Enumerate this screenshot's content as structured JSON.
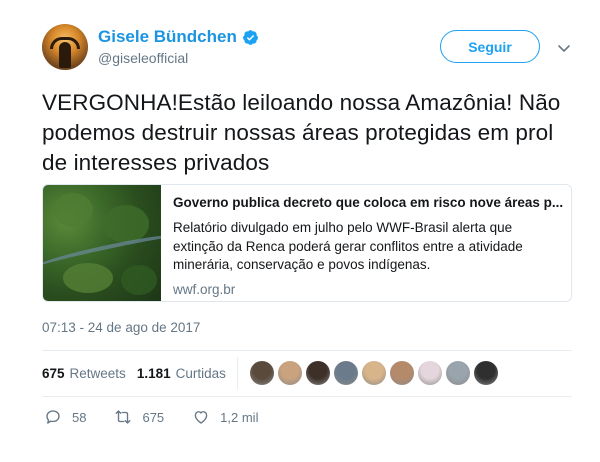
{
  "user": {
    "name": "Gisele Bündchen",
    "handle": "@giseleofficial",
    "follow_label": "Seguir"
  },
  "tweet": {
    "text": "VERGONHA!Estão leiloando nossa Amazônia! Não podemos destruir nossas áreas protegidas em prol de interesses privados",
    "timestamp": "07:13 - 24 de ago de 2017"
  },
  "card": {
    "title": "Governo publica decreto que coloca em risco nove áreas p...",
    "description": "Relatório divulgado em julho pelo WWF-Brasil alerta que extinção da Renca poderá gerar conflitos entre a atividade minerária, conservação e povos indígenas.",
    "domain": "wwf.org.br"
  },
  "stats": {
    "retweets_count": "675",
    "retweets_label": "Retweets",
    "likes_count": "1.181",
    "likes_label": "Curtidas"
  },
  "actions": {
    "reply_count": "58",
    "retweet_count": "675",
    "like_count": "1,2 mil"
  },
  "colors": {
    "accent": "#1da1f2",
    "name": "#1b95e0",
    "muted": "#657786",
    "text": "#14171a",
    "border": "#e1e8ed"
  },
  "liker_avatars": [
    "#5a4a3c",
    "#c9a27e",
    "#3d3028",
    "#6b7b8c",
    "#d8b48a",
    "#b58a6a",
    "#e4d6dc",
    "#9aa4ad",
    "#2f2f2f"
  ]
}
